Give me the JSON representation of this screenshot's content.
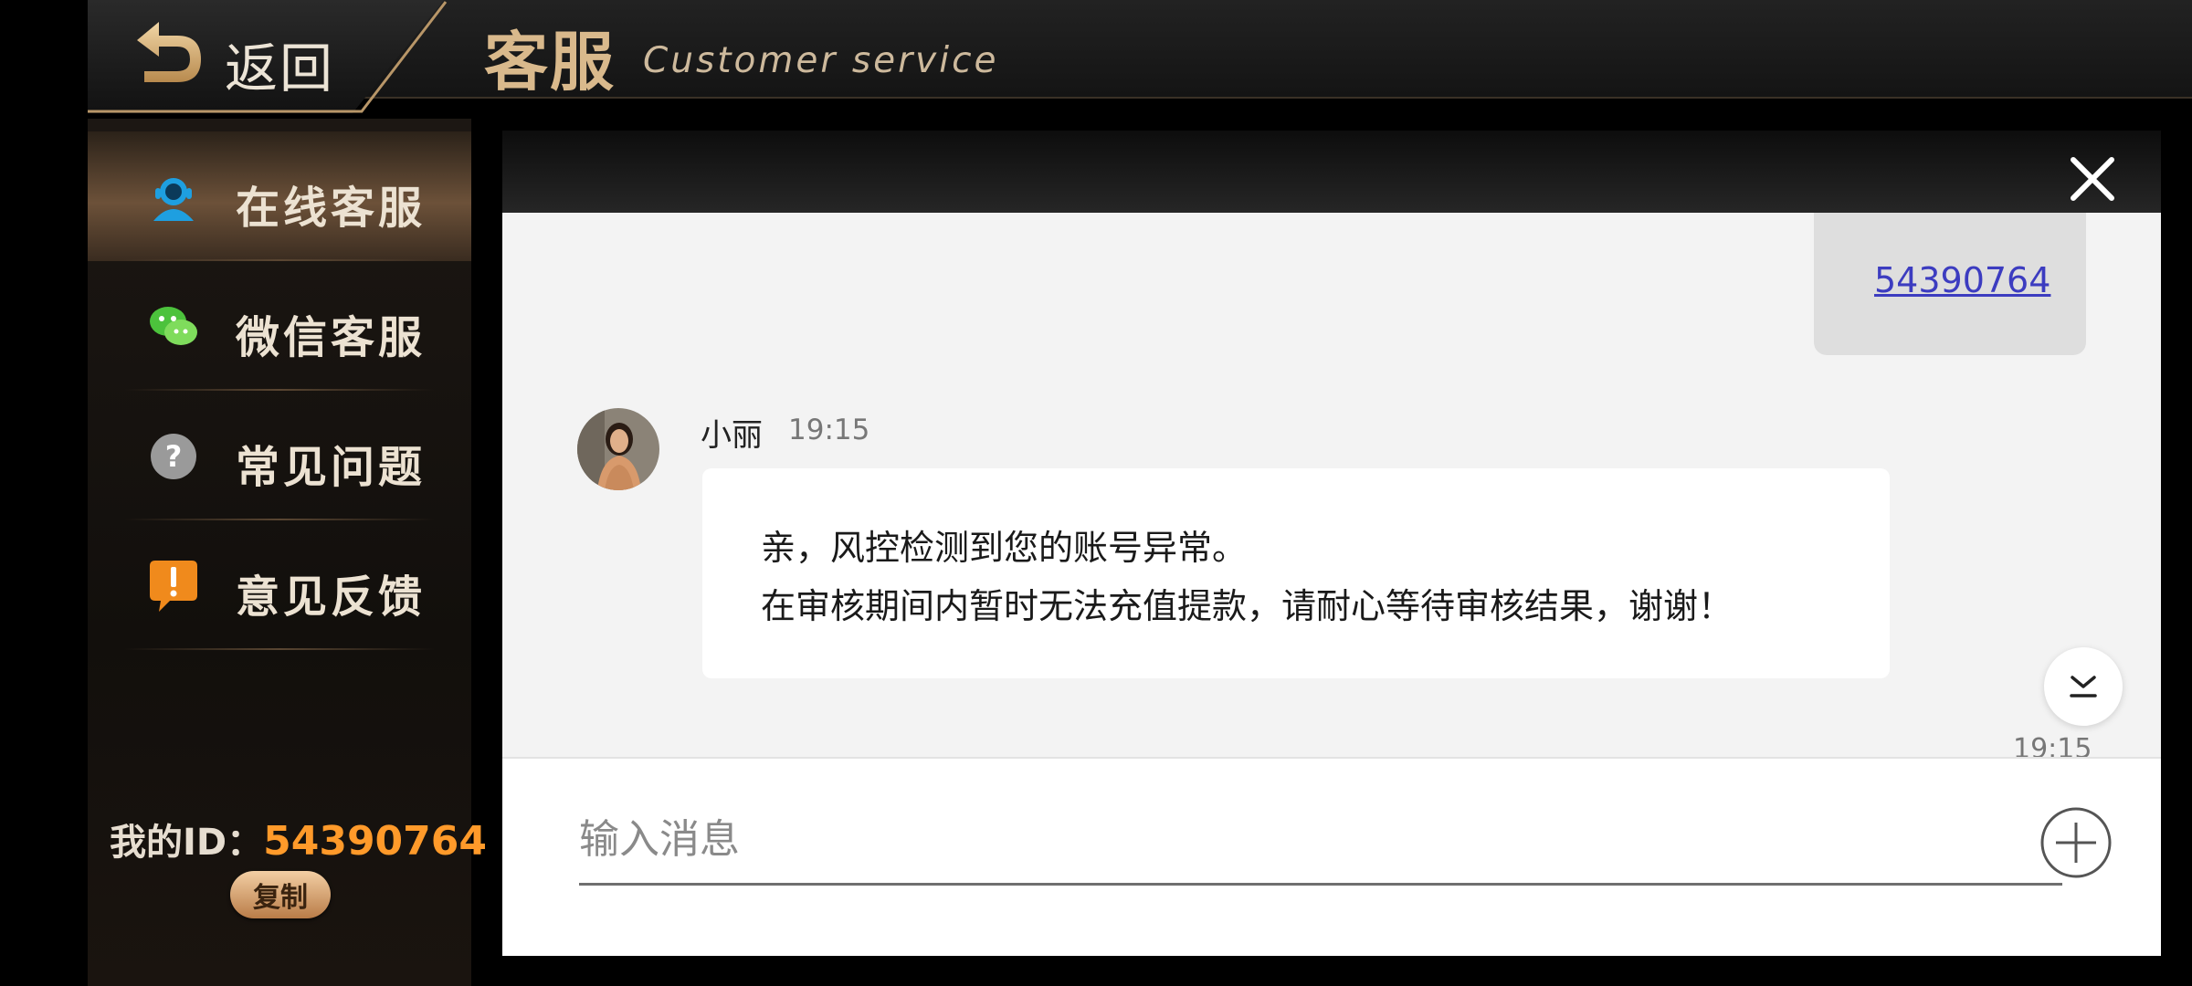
{
  "header": {
    "back_label": "返回",
    "title": "客服",
    "subtitle": "Customer service"
  },
  "sidebar": {
    "items": [
      {
        "label": "在线客服",
        "icon": "online-service-icon",
        "active": true
      },
      {
        "label": "微信客服",
        "icon": "wechat-icon",
        "active": false
      },
      {
        "label": "常见问题",
        "icon": "question-icon",
        "active": false
      },
      {
        "label": "意见反馈",
        "icon": "feedback-icon",
        "active": false
      }
    ],
    "my_id_label": "我的ID：",
    "my_id_value": "54390764",
    "copy_label": "复制"
  },
  "chat": {
    "user_message": "54390764",
    "agent": {
      "name": "小丽",
      "time": "19:15",
      "lines": [
        "亲，风控检测到您的账号异常。",
        "在审核期间内暂时无法充值提款，请耐心等待审核结果，谢谢！"
      ]
    },
    "bottom_time": "19:15",
    "input_placeholder": "输入消息"
  },
  "colors": {
    "accent_gold": "#d9b98c",
    "id_orange": "#ff9a2a",
    "link_blue": "#3c3cc0"
  }
}
